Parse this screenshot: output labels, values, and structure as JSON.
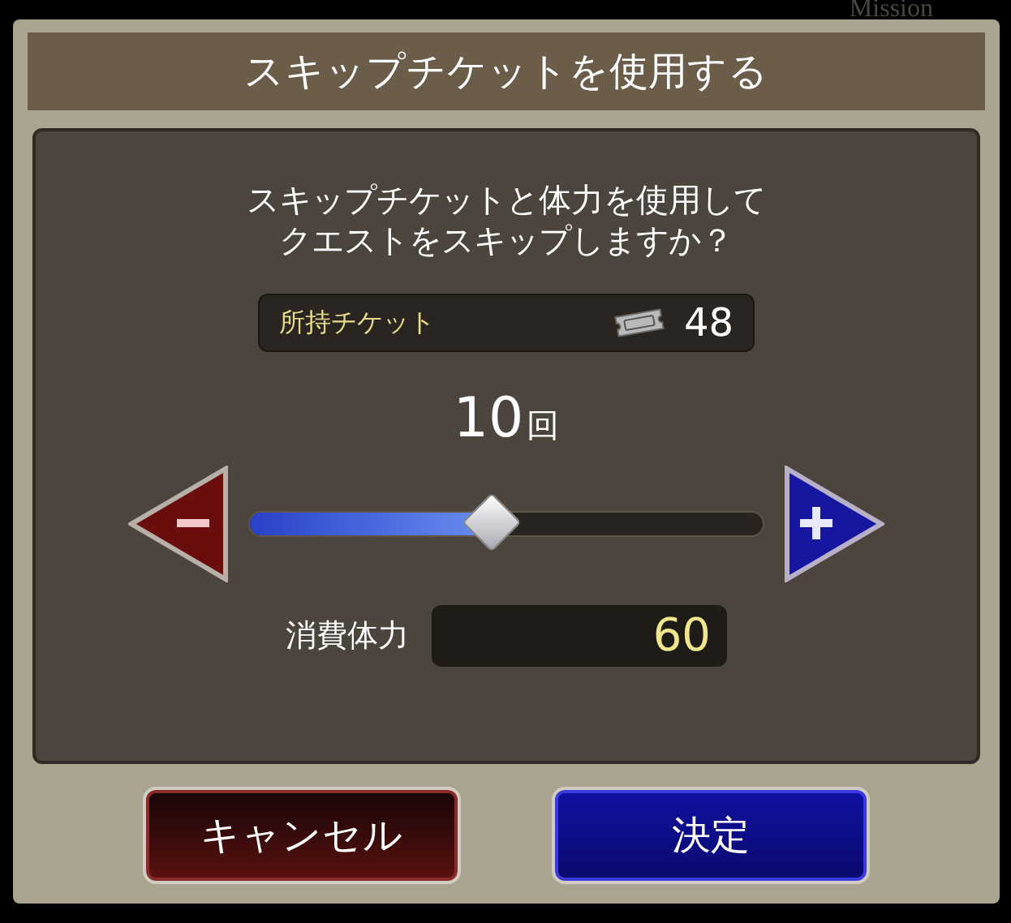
{
  "background": {
    "label": "Mission"
  },
  "dialog": {
    "title": "スキップチケットを使用する",
    "message_lines": [
      "スキップチケットと体力を使用して",
      "クエストをスキップしますか？"
    ],
    "ticket": {
      "label": "所持チケット",
      "count": "48"
    },
    "quantity": {
      "value": "10",
      "unit": "回"
    },
    "slider": {
      "level": 0.47
    },
    "stamina": {
      "label": "消費体力",
      "value": "60"
    },
    "buttons": [
      {
        "label": "キャンセル",
        "kind": "cancel"
      },
      {
        "label": "決定",
        "kind": "confirm"
      }
    ]
  }
}
